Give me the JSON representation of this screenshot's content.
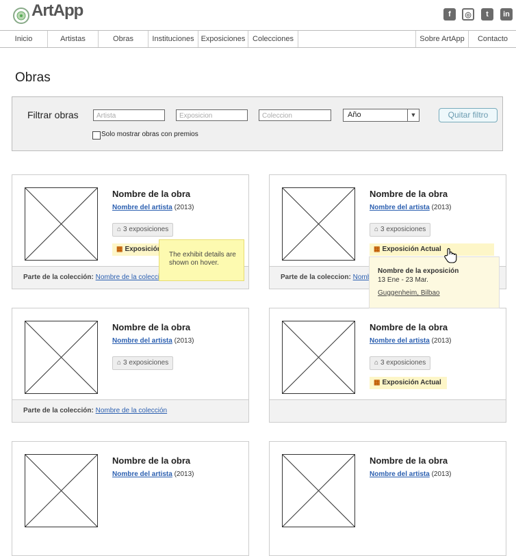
{
  "header": {
    "logo_text": "ArtApp",
    "social": [
      {
        "icon": "facebook-icon",
        "glyph": "f"
      },
      {
        "icon": "instagram-icon",
        "glyph": "◎"
      },
      {
        "icon": "twitter-icon",
        "glyph": "t"
      },
      {
        "icon": "linkedin-icon",
        "glyph": "in"
      }
    ]
  },
  "nav": {
    "items": [
      "Inicio",
      "Artistas",
      "Obras",
      "Instituciones",
      "Exposiciones",
      "Colecciones"
    ],
    "right_items": [
      "Sobre ArtApp",
      "Contacto"
    ]
  },
  "page": {
    "title": "Obras"
  },
  "filter": {
    "label": "Filtrar obras",
    "artist_placeholder": "Artista",
    "exhibition_placeholder": "Exposicion",
    "collection_placeholder": "Coleccion",
    "year_value": "Año",
    "clear_label": "Quitar filtro",
    "awards_label": "Solo mostrar obras con premios"
  },
  "cards": [
    {
      "title": "Nombre de la obra",
      "artist": "Nombre del artista",
      "year": "(2013)",
      "exhibitions": "3 exposiciones",
      "current": "Exposición Actual",
      "collection_label": "Parte de la colección:",
      "collection_link": "Nombre de la colección"
    },
    {
      "title": "Nombre de la obra",
      "artist": "Nombre del artista",
      "year": "(2013)",
      "exhibitions": "3 exposiciones",
      "current": "Exposición Actual",
      "collection_label": "Parte de la coleccion:",
      "collection_link": "Nombre de la colección"
    },
    {
      "title": "Nombre de la obra",
      "artist": "Nombre del artista",
      "year": "(2013)",
      "exhibitions": "3 exposiciones",
      "current": "",
      "collection_label": "Parte de la colección:",
      "collection_link": "Nombre de la colección"
    },
    {
      "title": "Nombre de la obra",
      "artist": "Nombre del artista",
      "year": "(2013)",
      "exhibitions": "3 exposiciones",
      "current": "Exposición Actual",
      "collection_label": "",
      "collection_link": ""
    },
    {
      "title": "Nombre de la obra",
      "artist": "Nombre del artista",
      "year": "(2013)"
    },
    {
      "title": "Nombre de la obra",
      "artist": "Nombre del artista",
      "year": "(2013)"
    }
  ],
  "annotation": {
    "text": "The exhibit details are shown on hover."
  },
  "hover_popup": {
    "title": "Nombre de la exposición",
    "dates": "13 Ene - 23 Mar.",
    "venue": "Guggenheim, Bilbao"
  },
  "colors": {
    "link": "#2b5fb0",
    "highlight": "#fdf6c8",
    "note": "#fdfab0"
  }
}
